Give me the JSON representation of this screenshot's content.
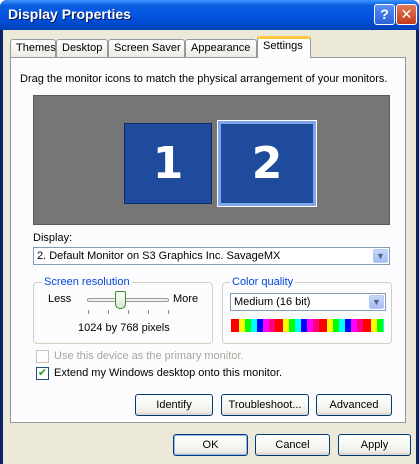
{
  "window": {
    "title": "Display Properties",
    "help_glyph": "?",
    "close_glyph": "✕"
  },
  "tabs": [
    {
      "label": "Themes"
    },
    {
      "label": "Desktop"
    },
    {
      "label": "Screen Saver"
    },
    {
      "label": "Appearance"
    },
    {
      "label": "Settings"
    }
  ],
  "settings": {
    "instructions": "Drag the monitor icons to match the physical arrangement of your monitors.",
    "monitors": [
      {
        "number": "1"
      },
      {
        "number": "2"
      }
    ],
    "display_label": "Display:",
    "display_value": "2. Default Monitor on S3 Graphics Inc. SavageMX",
    "screen_resolution": {
      "title": "Screen resolution",
      "less": "Less",
      "more": "More",
      "value": "1024 by 768 pixels"
    },
    "color_quality": {
      "title": "Color quality",
      "value": "Medium (16 bit)"
    },
    "primary_monitor": {
      "label": "Use this device as the primary monitor.",
      "checked": false,
      "enabled": false
    },
    "extend_desktop": {
      "label": "Extend my Windows desktop onto this monitor.",
      "checked": true
    },
    "buttons": {
      "identify": "Identify",
      "troubleshoot": "Troubleshoot...",
      "advanced": "Advanced"
    }
  },
  "dialog_buttons": {
    "ok": "OK",
    "cancel": "Cancel",
    "apply": "Apply"
  },
  "icons": {
    "dropdown": "▼",
    "check": "✔"
  },
  "colors": {
    "titlebar": "#0054e3",
    "panel": "#fcfcfe",
    "dialog_bg": "#ece9d8",
    "monitor": "#1e4b9b",
    "monitor_area": "#767676",
    "group_title": "#0046d5"
  }
}
